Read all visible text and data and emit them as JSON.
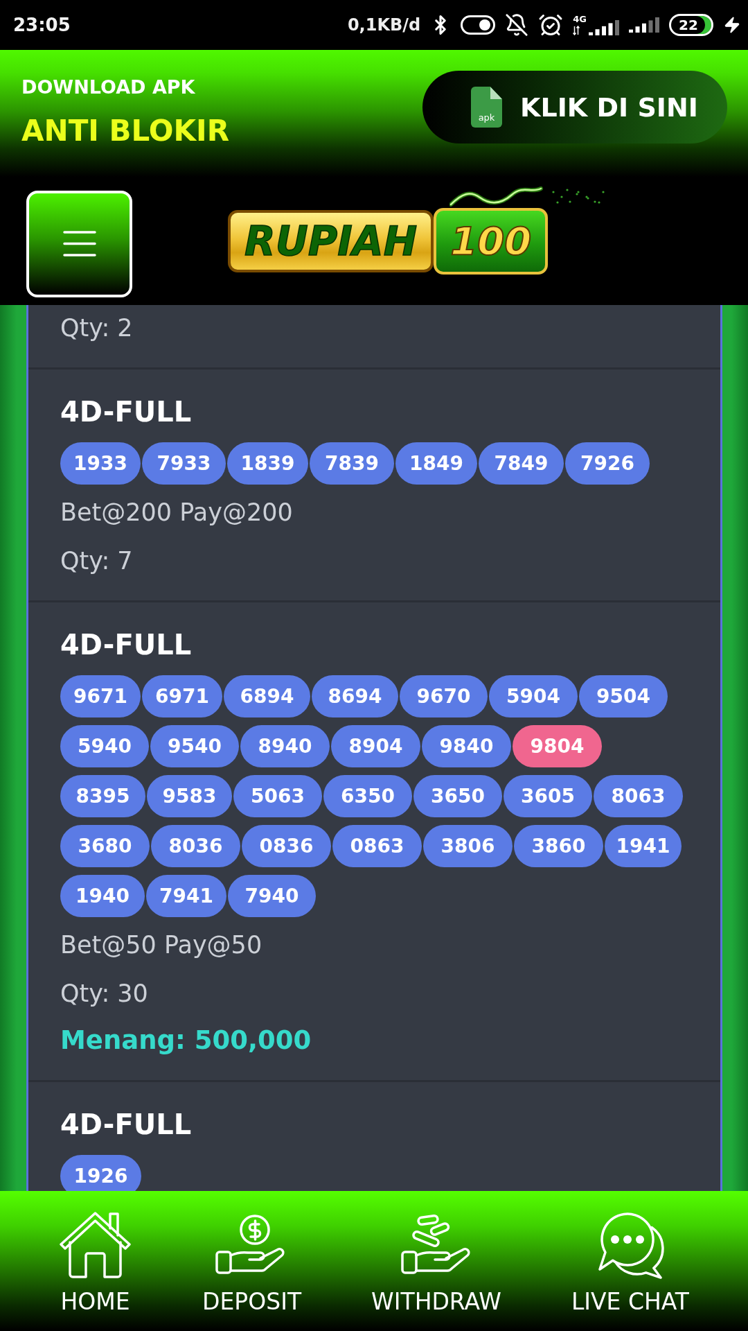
{
  "status_bar": {
    "time": "23:05",
    "data_rate": "0,1KB/d",
    "network_type": "4G",
    "battery": "22"
  },
  "banner": {
    "subtitle": "DOWNLOAD APK",
    "title": "ANTI BLOKIR",
    "button": {
      "file_label": "apk",
      "label": "KLIK DI SINI"
    }
  },
  "logo": {
    "word": "RUPIAH",
    "number": "100"
  },
  "bets": [
    {
      "qty": "Qty: 2"
    },
    {
      "title": "4D-FULL",
      "numbers": [
        {
          "value": "1933",
          "winning": false
        },
        {
          "value": "7933",
          "winning": false
        },
        {
          "value": "1839",
          "winning": false
        },
        {
          "value": "7839",
          "winning": false
        },
        {
          "value": "1849",
          "winning": false
        },
        {
          "value": "7849",
          "winning": false
        },
        {
          "value": "7926",
          "winning": false
        }
      ],
      "bet": "Bet@200 Pay@200",
      "qty": "Qty: 7"
    },
    {
      "title": "4D-FULL",
      "numbers": [
        {
          "value": "9671",
          "winning": false
        },
        {
          "value": "6971",
          "winning": false
        },
        {
          "value": "6894",
          "winning": false
        },
        {
          "value": "8694",
          "winning": false
        },
        {
          "value": "9670",
          "winning": false
        },
        {
          "value": "5904",
          "winning": false
        },
        {
          "value": "9504",
          "winning": false
        },
        {
          "value": "5940",
          "winning": false
        },
        {
          "value": "9540",
          "winning": false
        },
        {
          "value": "8940",
          "winning": false
        },
        {
          "value": "8904",
          "winning": false
        },
        {
          "value": "9840",
          "winning": false
        },
        {
          "value": "9804",
          "winning": true
        },
        {
          "value": "8395",
          "winning": false
        },
        {
          "value": "9583",
          "winning": false
        },
        {
          "value": "5063",
          "winning": false
        },
        {
          "value": "6350",
          "winning": false
        },
        {
          "value": "3650",
          "winning": false
        },
        {
          "value": "3605",
          "winning": false
        },
        {
          "value": "8063",
          "winning": false
        },
        {
          "value": "3680",
          "winning": false
        },
        {
          "value": "8036",
          "winning": false
        },
        {
          "value": "0836",
          "winning": false
        },
        {
          "value": "0863",
          "winning": false
        },
        {
          "value": "3806",
          "winning": false
        },
        {
          "value": "3860",
          "winning": false
        },
        {
          "value": "1941",
          "winning": false
        },
        {
          "value": "1940",
          "winning": false
        },
        {
          "value": "7941",
          "winning": false
        },
        {
          "value": "7940",
          "winning": false
        }
      ],
      "bet": "Bet@50 Pay@50",
      "qty": "Qty: 30",
      "win": "Menang: 500,000"
    },
    {
      "title": "4D-FULL",
      "numbers": [
        {
          "value": "1926",
          "winning": false
        }
      ]
    }
  ],
  "bottom_nav": [
    "HOME",
    "DEPOSIT",
    "WITHDRAW",
    "LIVE CHAT"
  ]
}
